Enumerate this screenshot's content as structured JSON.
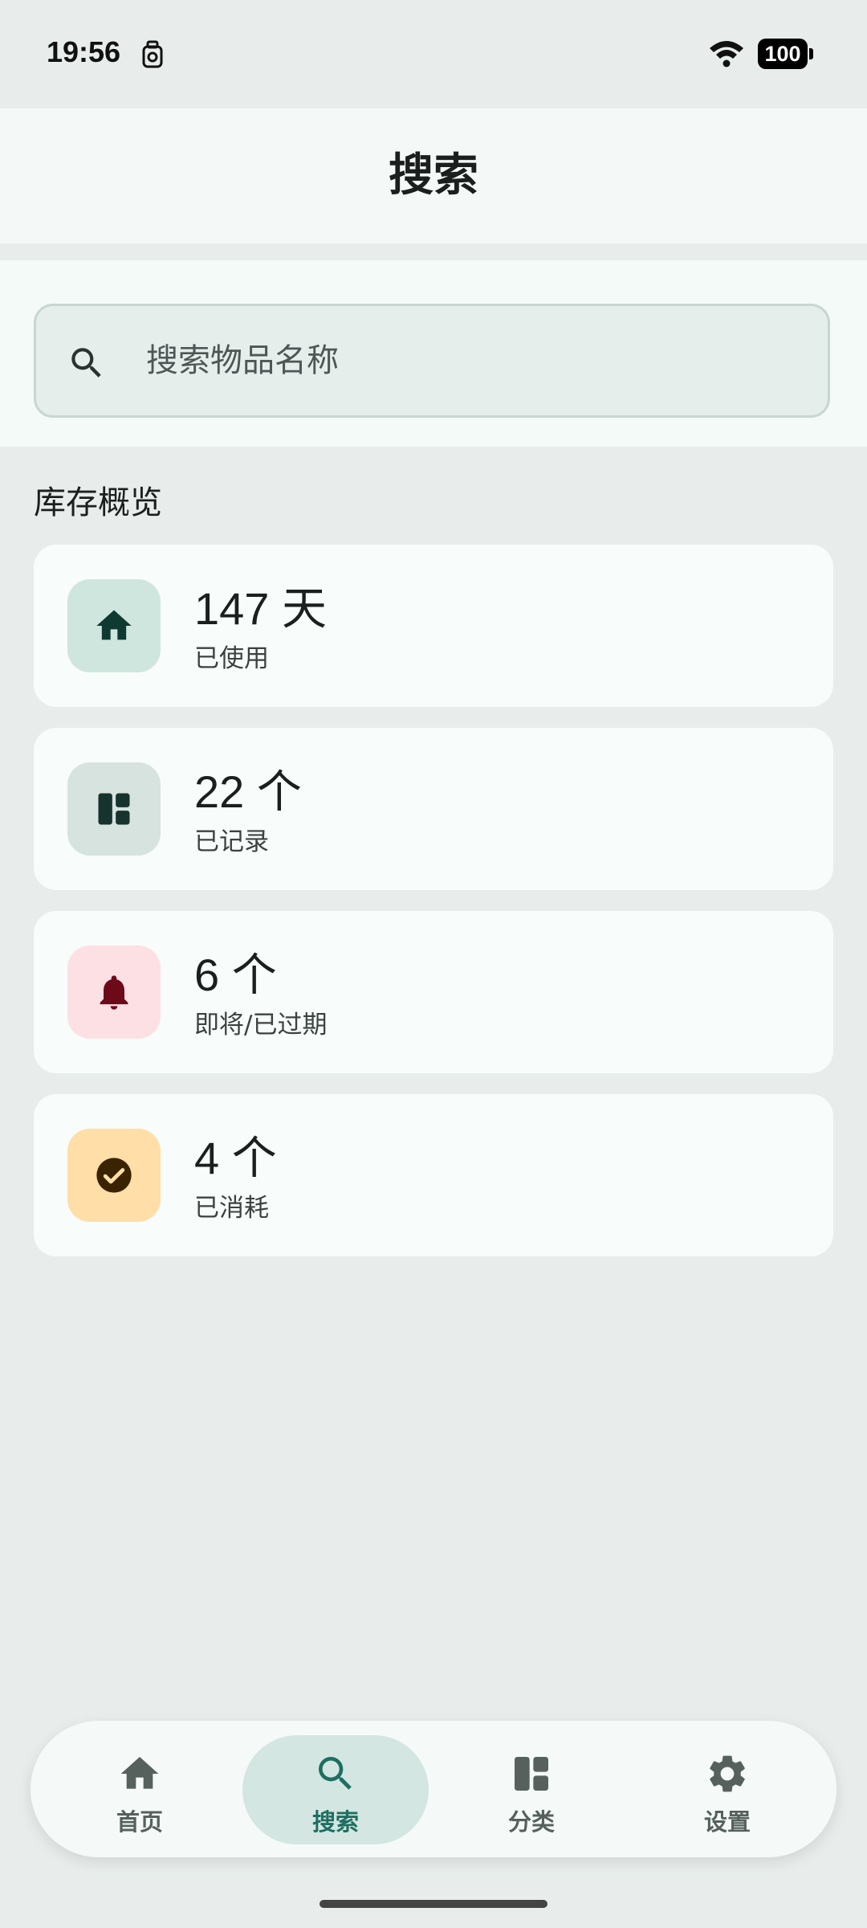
{
  "status_bar": {
    "time": "19:56",
    "battery": "100"
  },
  "header": {
    "title": "搜索"
  },
  "search": {
    "placeholder": "搜索物品名称"
  },
  "overview": {
    "title": "库存概览",
    "cards": [
      {
        "value": "147 天",
        "label": "已使用",
        "icon": "home-icon",
        "bg": "#cfe6de",
        "fg": "#0e3a32"
      },
      {
        "value": "22 个",
        "label": "已记录",
        "icon": "dashboard-icon",
        "bg": "#d6e3df",
        "fg": "#17332d"
      },
      {
        "value": "6 个",
        "label": "即将/已过期",
        "icon": "bell-icon",
        "bg": "#fde0e3",
        "fg": "#6d0a1a"
      },
      {
        "value": "4 个",
        "label": "已消耗",
        "icon": "check-circle-icon",
        "bg": "#ffdea8",
        "fg": "#3a2300"
      }
    ]
  },
  "nav": {
    "items": [
      {
        "label": "首页",
        "icon": "home-icon",
        "active": false
      },
      {
        "label": "搜索",
        "icon": "search-icon",
        "active": true
      },
      {
        "label": "分类",
        "icon": "dashboard-icon",
        "active": false
      },
      {
        "label": "设置",
        "icon": "gear-icon",
        "active": false
      }
    ],
    "active_color": "#1f6e62",
    "inactive_color": "#56615e"
  }
}
